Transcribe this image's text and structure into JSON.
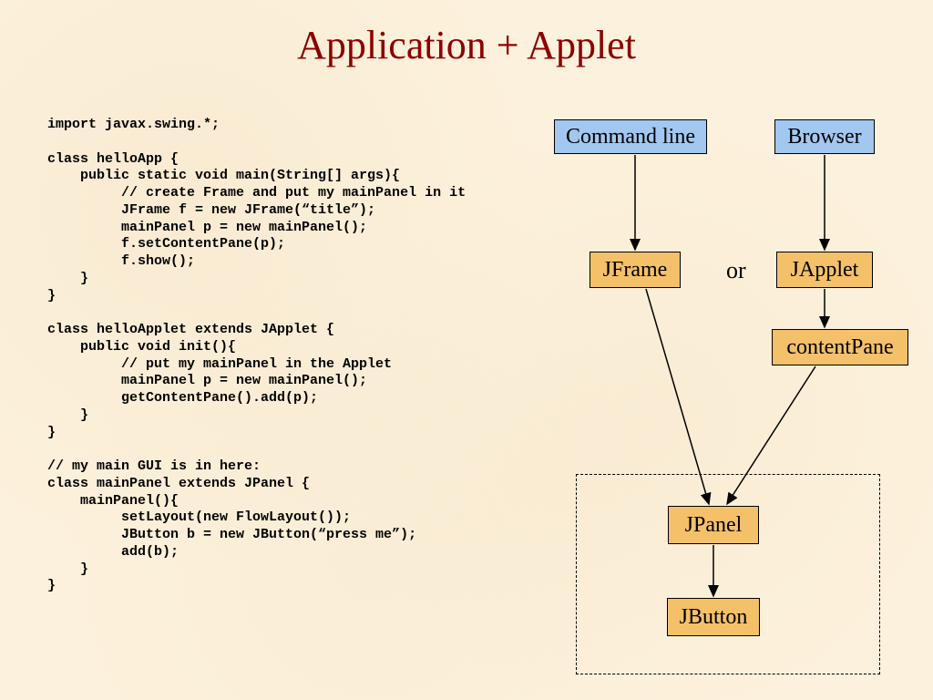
{
  "title": "Application + Applet",
  "code": "import javax.swing.*;\n\nclass helloApp {\n    public static void main(String[] args){\n         // create Frame and put my mainPanel in it\n         JFrame f = new JFrame(“title”);\n         mainPanel p = new mainPanel();\n         f.setContentPane(p);\n         f.show();\n    }\n}\n\nclass helloApplet extends JApplet {\n    public void init(){\n         // put my mainPanel in the Applet\n         mainPanel p = new mainPanel();\n         getContentPane().add(p);\n    }\n}\n\n// my main GUI is in here:\nclass mainPanel extends JPanel {\n    mainPanel(){\n         setLayout(new FlowLayout());\n         JButton b = new JButton(“press me”);\n         add(b);\n    }\n}",
  "diagram": {
    "cmdline": "Command line",
    "browser": "Browser",
    "jframe": "JFrame",
    "or": "or",
    "japplet": "JApplet",
    "contentpane": "contentPane",
    "jpanel": "JPanel",
    "jbutton": "JButton"
  }
}
